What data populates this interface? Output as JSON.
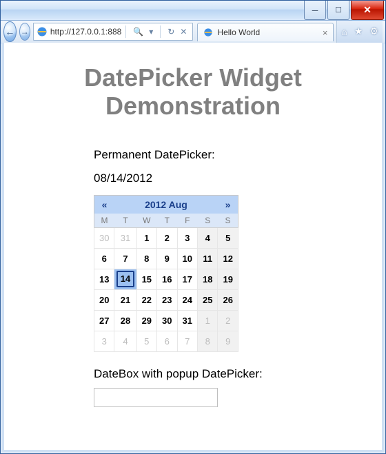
{
  "browser": {
    "url": "http://127.0.0.1:888",
    "search_hint": "",
    "tab_title": "Hello World",
    "icons": {
      "back": "back-arrow-icon",
      "forward": "forward-arrow-icon",
      "search": "search-icon",
      "reload": "reload-icon",
      "stop": "stop-icon",
      "home": "home-icon",
      "favorites": "favorites-icon",
      "tools": "tools-icon",
      "minimize": "minimize-icon",
      "maximize": "maximize-icon",
      "close": "close-icon",
      "tab_close": "tab-close-icon",
      "ie": "ie-logo-icon"
    }
  },
  "page": {
    "heading": "DatePicker Widget Demonstration",
    "permanent_label": "Permanent DatePicker:",
    "selected_date_text": "08/14/2012",
    "popup_label": "DateBox with popup DatePicker:",
    "datebox_value": ""
  },
  "calendar": {
    "title": "2012 Aug",
    "prev": "«",
    "next": "»",
    "dow": [
      "M",
      "T",
      "W",
      "T",
      "F",
      "S",
      "S"
    ],
    "weeks": [
      [
        {
          "d": 30,
          "o": true
        },
        {
          "d": 31,
          "o": true
        },
        {
          "d": 1
        },
        {
          "d": 2
        },
        {
          "d": 3
        },
        {
          "d": 4,
          "w": true
        },
        {
          "d": 5,
          "w": true
        }
      ],
      [
        {
          "d": 6
        },
        {
          "d": 7
        },
        {
          "d": 8
        },
        {
          "d": 9
        },
        {
          "d": 10
        },
        {
          "d": 11,
          "w": true
        },
        {
          "d": 12,
          "w": true
        }
      ],
      [
        {
          "d": 13
        },
        {
          "d": 14,
          "sel": true
        },
        {
          "d": 15
        },
        {
          "d": 16
        },
        {
          "d": 17
        },
        {
          "d": 18,
          "w": true
        },
        {
          "d": 19,
          "w": true
        }
      ],
      [
        {
          "d": 20
        },
        {
          "d": 21
        },
        {
          "d": 22
        },
        {
          "d": 23
        },
        {
          "d": 24
        },
        {
          "d": 25,
          "w": true
        },
        {
          "d": 26,
          "w": true
        }
      ],
      [
        {
          "d": 27
        },
        {
          "d": 28
        },
        {
          "d": 29
        },
        {
          "d": 30
        },
        {
          "d": 31
        },
        {
          "d": 1,
          "o": true,
          "w": true
        },
        {
          "d": 2,
          "o": true,
          "w": true
        }
      ],
      [
        {
          "d": 3,
          "o": true
        },
        {
          "d": 4,
          "o": true
        },
        {
          "d": 5,
          "o": true
        },
        {
          "d": 6,
          "o": true
        },
        {
          "d": 7,
          "o": true
        },
        {
          "d": 8,
          "o": true,
          "w": true
        },
        {
          "d": 9,
          "o": true,
          "w": true
        }
      ]
    ]
  }
}
